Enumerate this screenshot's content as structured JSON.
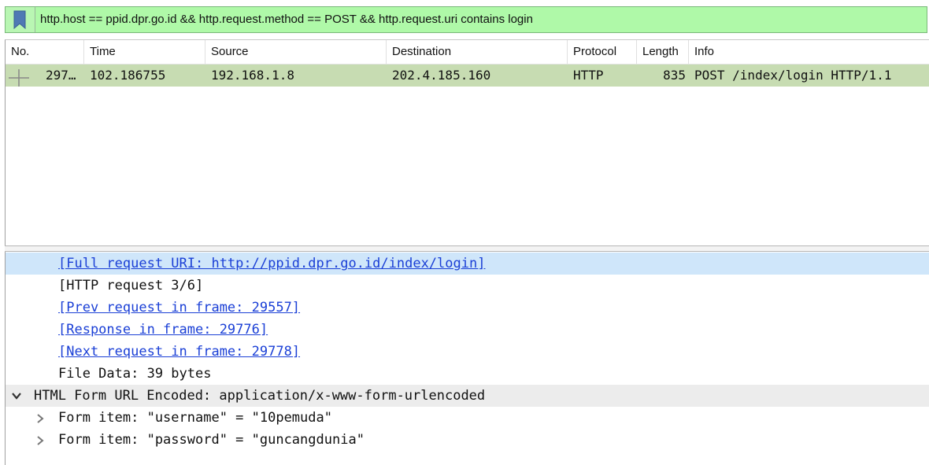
{
  "filter": {
    "value": "http.host == ppid.dpr.go.id && http.request.method == POST && http.request.uri contains login"
  },
  "packet_list": {
    "columns": [
      "No.",
      "Time",
      "Source",
      "Destination",
      "Protocol",
      "Length",
      "Info"
    ],
    "rows": [
      {
        "no": "297…",
        "time": "102.186755",
        "source": "192.168.1.8",
        "destination": "202.4.185.160",
        "protocol": "HTTP",
        "length": "835",
        "info": "POST /index/login HTTP/1.1"
      }
    ]
  },
  "details": {
    "lines": [
      "[Full request URI: http://ppid.dpr.go.id/index/login]",
      "[HTTP request 3/6]",
      "[Prev request in frame: 29557]",
      "[Response in frame: 29776]",
      "[Next request in frame: 29778]",
      "File Data: 39 bytes",
      "HTML Form URL Encoded: application/x-www-form-urlencoded",
      "Form item: \"username\" = \"10pemuda\"",
      "Form item: \"password\" = \"guncangdunia\""
    ]
  },
  "colors": {
    "filter_valid": "#aff9a8",
    "selected_row": "#c7dcb2",
    "link": "#1a3fd6",
    "highlight": "#cfe6fa"
  },
  "icons": {
    "bookmark": "bookmark-icon",
    "related_packet": "related-packet-icon",
    "expanded": "chevron-down-icon",
    "collapsed": "chevron-right-icon"
  }
}
